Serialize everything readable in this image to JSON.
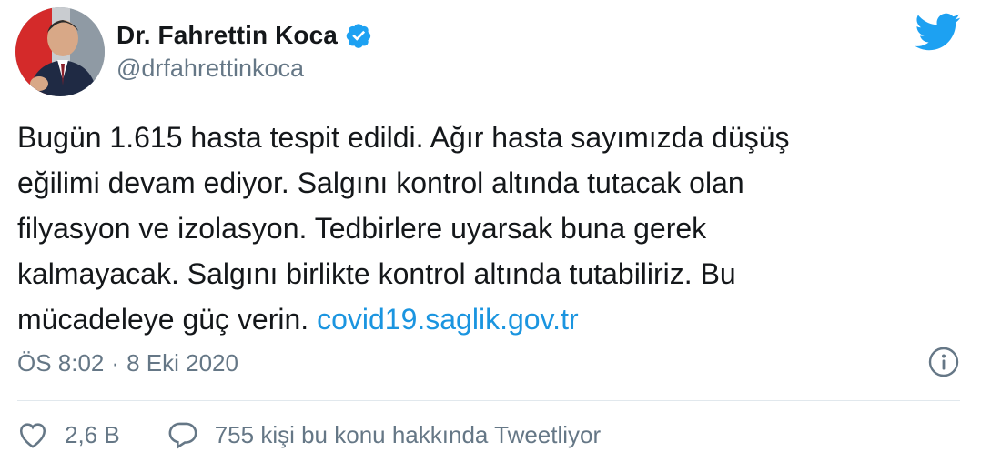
{
  "author": {
    "display_name": "Dr. Fahrettin Koca",
    "handle": "@drfahrettinkoca",
    "avatar_icon": "profile-photo",
    "verified_icon": "verified-badge-icon"
  },
  "brand": {
    "logo_icon": "twitter-bird-icon",
    "accent_color": "#1da1f2",
    "link_color": "#1b95e0"
  },
  "tweet": {
    "text": "Bugün 1.615 hasta tespit edildi. Ağır hasta sayımızda düşüş\neğilimi devam ediyor. Salgını kontrol altında tutacak olan\nfilyasyon ve izolasyon. Tedbirlere uyarsak buna gerek\nkalmayacak. Salgını birlikte kontrol altında tutabiliriz. Bu\nmücadeleye güç verin. ",
    "link": "covid19.saglik.gov.tr"
  },
  "meta": {
    "time": "ÖS 8:02",
    "separator": "·",
    "date": "8 Eki 2020",
    "info_icon": "info-icon"
  },
  "actions": {
    "likes": "2,6 B",
    "replies": "755 kişi bu konu hakkında Tweetliyor"
  }
}
